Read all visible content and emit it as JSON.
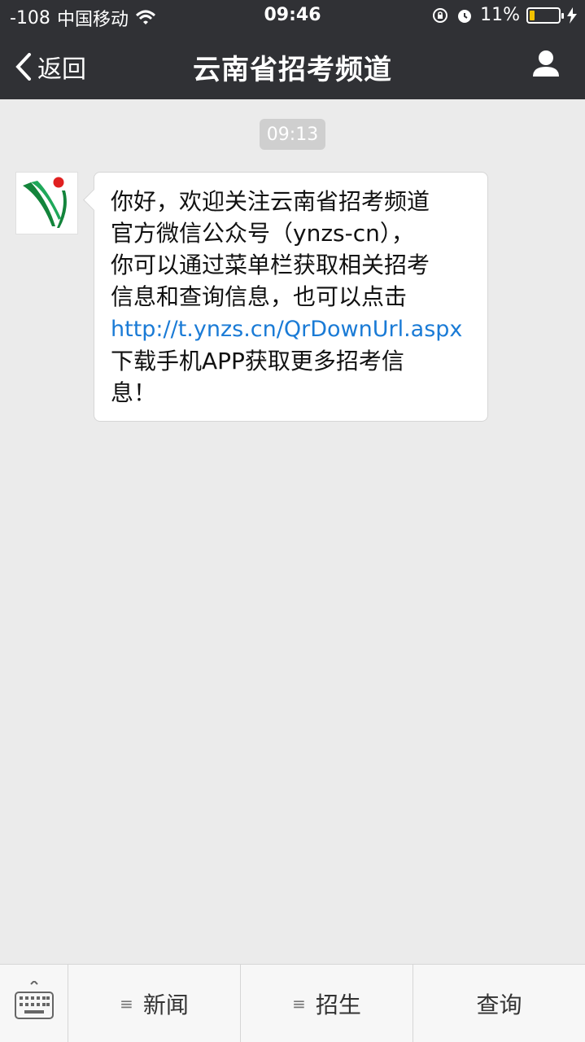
{
  "status_bar": {
    "signal": "-108",
    "carrier": "中国移动",
    "time": "09:46",
    "battery_percent": "11%"
  },
  "nav": {
    "back_label": "返回",
    "title": "云南省招考频道"
  },
  "chat": {
    "timestamp": "09:13",
    "message": {
      "text_lines": [
        "你好，欢迎关注云南省招考频道",
        "官方微信公众号（ynzs-cn），",
        "你可以通过菜单栏获取相关招考",
        "信息和查询信息，也可以点击"
      ],
      "link": "http://t.ynzs.cn/QrDownUrl.aspx",
      "tail_lines": [
        "下载手机APP获取更多招考信",
        "息！"
      ]
    }
  },
  "bottom_menu": {
    "items": [
      {
        "label": "新闻"
      },
      {
        "label": "招生"
      },
      {
        "label": "查询"
      }
    ]
  },
  "colors": {
    "header_bg": "#303135",
    "chat_bg": "#ebebeb",
    "link": "#1a7bd6",
    "battery": "#f2c200"
  }
}
